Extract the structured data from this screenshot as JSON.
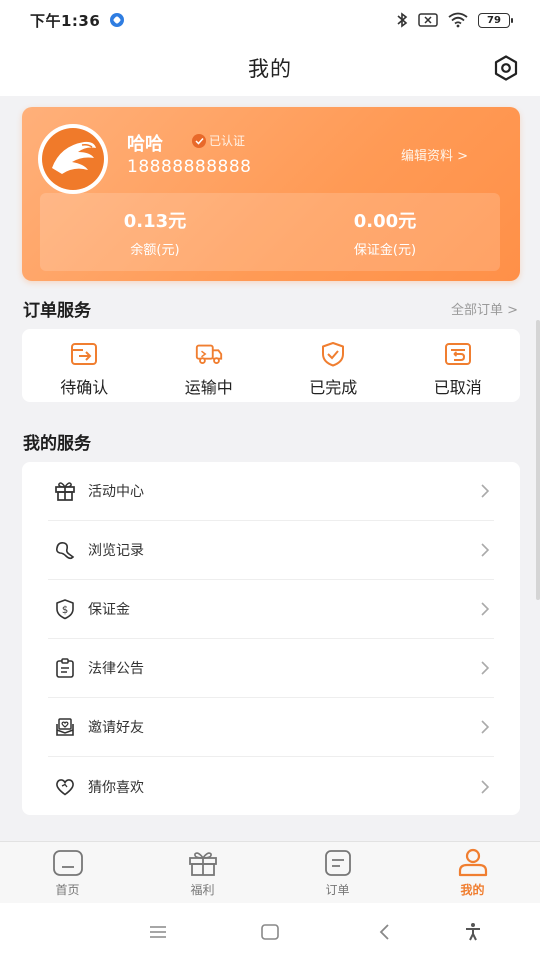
{
  "status_bar": {
    "time": "下午1:36",
    "battery": "79"
  },
  "header": {
    "title": "我的"
  },
  "profile": {
    "name": "哈哈",
    "verified_label": "已认证",
    "phone": "18888888888",
    "edit_label": "编辑资料 >",
    "balance_value": "0.13元",
    "balance_label": "余额(元)",
    "deposit_value": "0.00元",
    "deposit_label": "保证金(元)"
  },
  "order_service": {
    "title": "订单服务",
    "all_link": "全部订单 >",
    "items": [
      {
        "label": "待确认",
        "icon": "pending-confirm-icon"
      },
      {
        "label": "运输中",
        "icon": "truck-icon"
      },
      {
        "label": "已完成",
        "icon": "shield-check-icon"
      },
      {
        "label": "已取消",
        "icon": "cancel-return-icon"
      }
    ]
  },
  "my_services": {
    "title": "我的服务",
    "items": [
      {
        "label": "活动中心",
        "icon": "gift-icon"
      },
      {
        "label": "浏览记录",
        "icon": "footprint-icon"
      },
      {
        "label": "保证金",
        "icon": "dollar-shield-icon"
      },
      {
        "label": "法律公告",
        "icon": "clipboard-icon"
      },
      {
        "label": "邀请好友",
        "icon": "mail-heart-icon"
      },
      {
        "label": "猜你喜欢",
        "icon": "heart-icon"
      }
    ]
  },
  "tab_bar": {
    "items": [
      {
        "label": "首页",
        "icon": "home-icon"
      },
      {
        "label": "福利",
        "icon": "gift-icon"
      },
      {
        "label": "订单",
        "icon": "order-icon"
      },
      {
        "label": "我的",
        "icon": "person-icon",
        "active": true
      }
    ]
  },
  "colors": {
    "accent": "#f07e30",
    "card_gradient_start": "#ffb07a",
    "card_gradient_end": "#ff9048"
  }
}
